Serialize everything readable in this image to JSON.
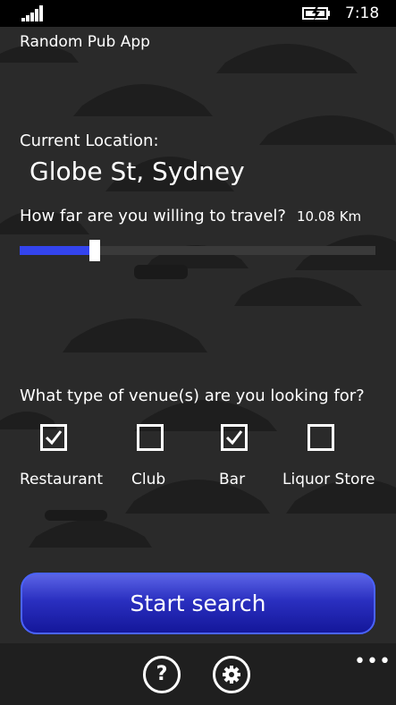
{
  "status_bar": {
    "time": "7:18",
    "signal_icon": "signal-strength-icon",
    "battery_icon": "battery-charging-icon"
  },
  "app": {
    "title": "Random Pub App"
  },
  "location": {
    "label": "Current Location:",
    "value": "Globe St, Sydney"
  },
  "travel": {
    "question": "How far are you willing to travel?",
    "distance_label": "10.08 Km",
    "slider_fraction": 0.21,
    "accent": "#3344ee"
  },
  "venues": {
    "question": "What type of venue(s) are you looking for?",
    "options": [
      {
        "label": "Restaurant",
        "checked": true
      },
      {
        "label": "Club",
        "checked": false
      },
      {
        "label": "Bar",
        "checked": true
      },
      {
        "label": "Liquor Store",
        "checked": false
      }
    ]
  },
  "actions": {
    "start_search": "Start search"
  },
  "app_bar": {
    "buttons": [
      {
        "icon": "help-icon"
      },
      {
        "icon": "settings-icon"
      }
    ],
    "more_label": "•••"
  },
  "colors": {
    "background": "#2a2a2a",
    "button_gradient_top": "#5b64e6",
    "button_gradient_bottom": "#14179a",
    "button_border": "#4a63ff"
  }
}
